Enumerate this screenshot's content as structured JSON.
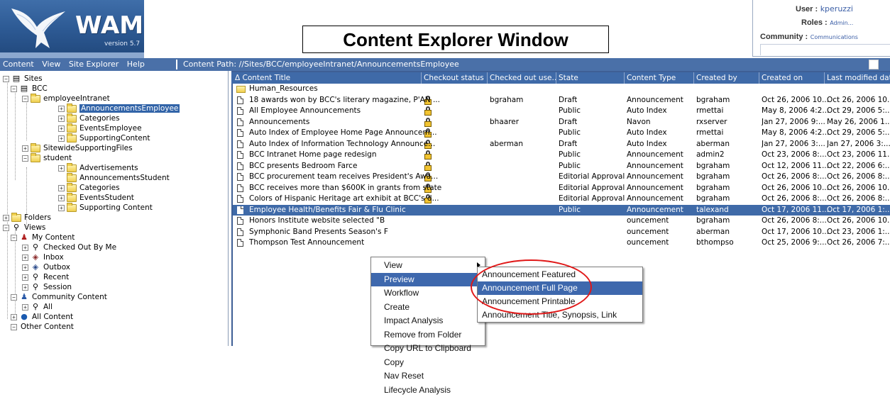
{
  "app": {
    "logo_text": "WAM",
    "version": "version 5.7",
    "window_title": "Content Explorer Window"
  },
  "user": {
    "user_label": "User :",
    "user_value": "kperuzzi",
    "roles_label": "Roles :",
    "roles_value": "Admin...",
    "community_label": "Community :",
    "community_value": "Communications"
  },
  "toolbar": {
    "menu": [
      "Content",
      "View",
      "Site Explorer",
      "Help"
    ],
    "path_label": "Content Path:",
    "path_value": "//Sites/BCC/employeeIntranet/AnnouncementsEmployee"
  },
  "tree": {
    "sites": "Sites",
    "bcc": "BCC",
    "employeeIntranet": "employeeIntranet",
    "announcementsEmployee": "AnnouncementsEmployee",
    "categories1": "Categories",
    "eventsEmployee": "EventsEmployee",
    "supportingContent1": "SupportingContent",
    "sitewide": "SitewideSupportingFiles",
    "student": "student",
    "advertisements": "Advertisements",
    "announcementsStudent": "AnnouncementsStudent",
    "categories2": "Categories",
    "eventsStudent": "EventsStudent",
    "supportingContent2": "Supporting Content",
    "folders": "Folders",
    "views": "Views",
    "myContent": "My Content",
    "checkedOut": "Checked Out By Me",
    "inbox": "Inbox",
    "outbox": "Outbox",
    "recent": "Recent",
    "session": "Session",
    "community": "Community Content",
    "all": "All",
    "allContent": "All Content",
    "otherContent": "Other Content"
  },
  "grid": {
    "headers": [
      "Δ Content Title",
      "Checkout status",
      "Checked out use...",
      "State",
      "Content Type",
      "Created by",
      "Created on",
      "Last modified date"
    ],
    "folder_row": "Human_Resources",
    "rows": [
      {
        "title": "18 awards won by BCC's literary magazine, P'AN ...",
        "locked": true,
        "user": "bgraham",
        "state": "Draft",
        "type": "Announcement",
        "by": "bgraham",
        "on": "Oct 26, 2006 10...",
        "mod": "Oct 26, 2006 10..."
      },
      {
        "title": "All Employee Announcements",
        "locked": true,
        "user": "",
        "state": "Public",
        "type": "Auto Index",
        "by": "rmettai",
        "on": "May 8, 2006 4:2...",
        "mod": "Oct 29, 2006 5:..."
      },
      {
        "title": "Announcements",
        "locked": true,
        "user": "bhaarer",
        "state": "Draft",
        "type": "Navon",
        "by": "rxserver",
        "on": "Jan 27, 2006 9:...",
        "mod": "May 26, 2006 1..."
      },
      {
        "title": "Auto Index of Employee Home Page Announcem...",
        "locked": true,
        "user": "",
        "state": "Public",
        "type": "Auto Index",
        "by": "rmettai",
        "on": "May 8, 2006 4:2...",
        "mod": "Oct 29, 2006 5:..."
      },
      {
        "title": "Auto Index of Information Technology Announce...",
        "locked": true,
        "user": "aberman",
        "state": "Draft",
        "type": "Auto Index",
        "by": "aberman",
        "on": "Jan 27, 2006 3:...",
        "mod": "Jan 27, 2006 3:..."
      },
      {
        "title": "BCC Intranet Home page redesign",
        "locked": true,
        "user": "",
        "state": "Public",
        "type": "Announcement",
        "by": "admin2",
        "on": "Oct 23, 2006 8:...",
        "mod": "Oct 23, 2006 11..."
      },
      {
        "title": "BCC presents Bedroom Farce",
        "locked": true,
        "user": "",
        "state": "Public",
        "type": "Announcement",
        "by": "bgraham",
        "on": "Oct 12, 2006 11...",
        "mod": "Oct 22, 2006 6:..."
      },
      {
        "title": "BCC procurement team receives President's Awa...",
        "locked": true,
        "user": "",
        "state": "Editorial Approval",
        "type": "Announcement",
        "by": "bgraham",
        "on": "Oct 26, 2006 8:...",
        "mod": "Oct 26, 2006 8:..."
      },
      {
        "title": "BCC receives more than $600K in grants from state",
        "locked": true,
        "user": "",
        "state": "Editorial Approval",
        "type": "Announcement",
        "by": "bgraham",
        "on": "Oct 26, 2006 10...",
        "mod": "Oct 26, 2006 10..."
      },
      {
        "title": "Colors of Hispanic Heritage art exhibit at BCC's d...",
        "locked": true,
        "user": "",
        "state": "Editorial Approval",
        "type": "Announcement",
        "by": "bgraham",
        "on": "Oct 26, 2006 8:...",
        "mod": "Oct 26, 2006 8:..."
      },
      {
        "title": "Employee Health/Benefits Fair & Flu Clinic",
        "locked": false,
        "user": "",
        "state": "Public",
        "type": "Announcement",
        "by": "talexand",
        "on": "Oct 17, 2006 11...",
        "mod": "Oct 17, 2006 1:...",
        "highlight": true
      },
      {
        "title": "Honors Institute website selected \"B",
        "locked": false,
        "user": "",
        "state": "",
        "type": "ouncement",
        "by": "bgraham",
        "on": "Oct 26, 2006 8:...",
        "mod": "Oct 26, 2006 10..."
      },
      {
        "title": "Symphonic Band Presents Season's F",
        "locked": false,
        "user": "",
        "state": "",
        "type": "ouncement",
        "by": "aberman",
        "on": "Oct 17, 2006 10...",
        "mod": "Oct 23, 2006 1:..."
      },
      {
        "title": "Thompson Test Announcement",
        "locked": false,
        "user": "",
        "state": "",
        "type": "ouncement",
        "by": "bthompso",
        "on": "Oct 25, 2006 9:...",
        "mod": "Oct 26, 2006 7:..."
      }
    ]
  },
  "context_menu": {
    "items": [
      "View",
      "Preview",
      "Workflow",
      "Create",
      "Impact Analysis",
      "Remove from Folder",
      "Copy URL to Clipboard",
      "Copy",
      "Nav Reset",
      "Lifecycle Analysis"
    ],
    "active": "Preview"
  },
  "submenu": {
    "items": [
      "Announcement Featured",
      "Announcement Full Page",
      "Announcement Printable",
      "Announcement Title, Synopsis, Link"
    ],
    "active": "Announcement Full Page"
  },
  "colors": {
    "toolbar": "#4a70a8",
    "highlight": "#3f6aa8",
    "annotation": "#e01818"
  }
}
